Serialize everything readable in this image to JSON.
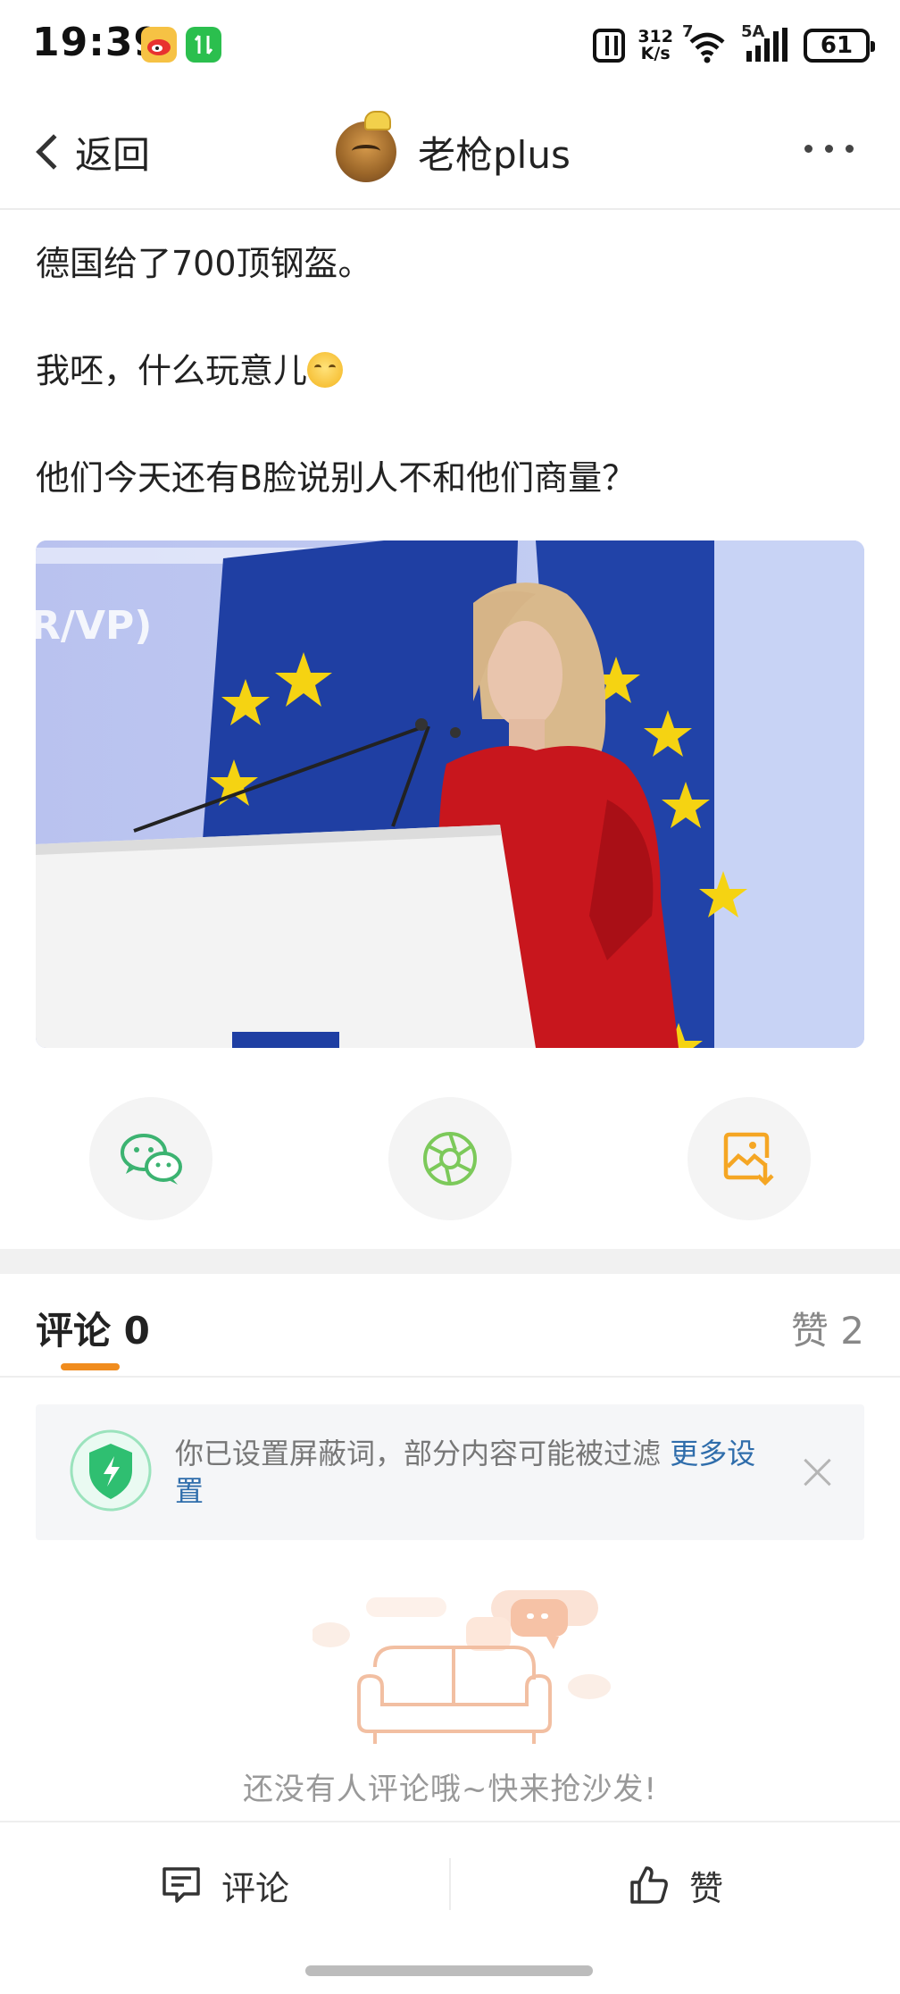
{
  "status_bar": {
    "time": "19:39",
    "net_speed_value": "312",
    "net_speed_unit": "K/s",
    "wifi_label": "7",
    "signal_label": "5A",
    "battery": "61"
  },
  "nav": {
    "back_label": "返回",
    "username": "老枪plus"
  },
  "post": {
    "lines": [
      "德国给了700顶钢盔。",
      "我呸，什么玩意儿",
      "他们今天还有B脸说别人不和他们商量？"
    ],
    "image_sign_text": "R/VP)"
  },
  "share": {
    "wechat_icon": "wechat-icon",
    "moments_icon": "moments-icon",
    "save_image_icon": "save-image-icon"
  },
  "tabs": {
    "comments_label": "评论",
    "comments_count": "0",
    "likes_label": "赞",
    "likes_count": "2"
  },
  "notice": {
    "text": "你已设置屏蔽词，部分内容可能被过滤",
    "link": "更多设置"
  },
  "empty_state": {
    "text": "还没有人评论哦~快来抢沙发!"
  },
  "bottom_bar": {
    "comment_label": "评论",
    "like_label": "赞"
  },
  "colors": {
    "accent": "#f08c1e",
    "link": "#2f6dab",
    "wechat_green": "#3cb371",
    "shield_green": "#2fbf71",
    "save_orange": "#f5a623"
  }
}
